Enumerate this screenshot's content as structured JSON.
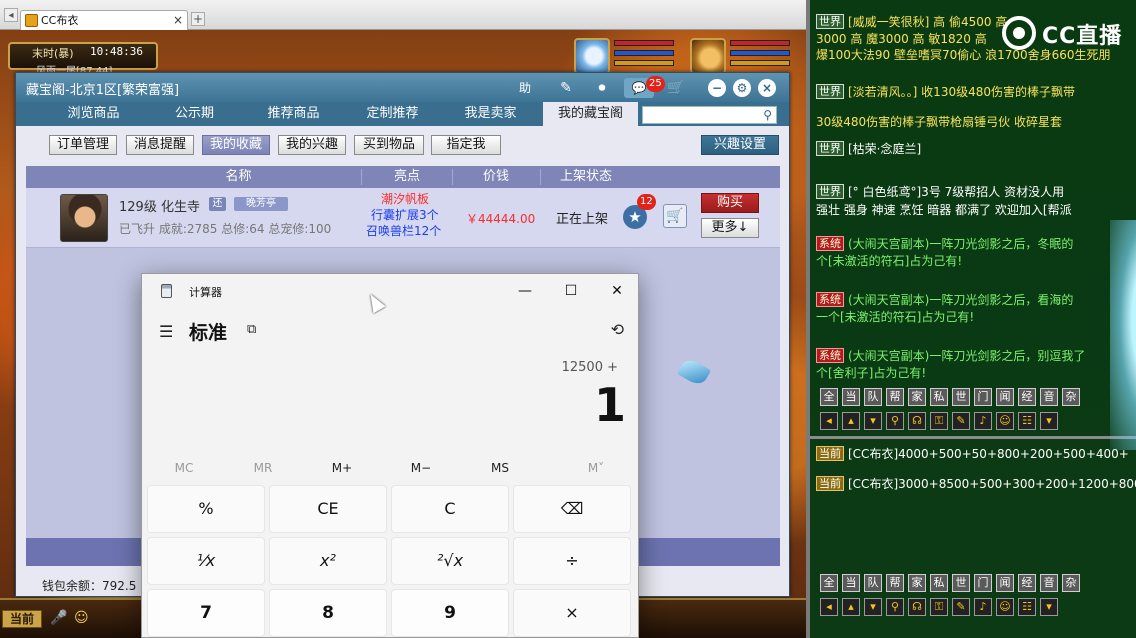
{
  "browser": {
    "tab_title": "CC布衣",
    "close_glyph": "×",
    "new_tab_glyph": "+",
    "arrow_glyph": "◂"
  },
  "game": {
    "hud_time_label": "末时(暴)",
    "hud_clock": "10:48:36",
    "map_text": "风雨一尾[87,44]"
  },
  "cbg": {
    "title": "藏宝阁-北京1区[繁荣富强]",
    "title_buttons": {
      "help": "助",
      "notify_count": "25"
    },
    "nav_tabs": [
      "浏览商品",
      "公示期",
      "推荐商品",
      "定制推荐",
      "我是卖家",
      "我的藏宝阁"
    ],
    "search_placeholder": "",
    "sub_buttons": [
      "订单管理",
      "消息提醒",
      "我的收藏",
      "我的兴趣",
      "买到物品",
      "指定我"
    ],
    "interest_button": "兴趣设置",
    "columns": [
      "名称",
      "亮点",
      "价钱",
      "上架状态"
    ],
    "row": {
      "level_school": "129级  化生寺",
      "tag1": "还",
      "tag2": "晚芳亭",
      "stats": "已飞升  成就:2785  总修:64  总宠修:100",
      "highlight1": "潮汐帆板",
      "highlight2": "行囊扩展3个",
      "highlight3": "召唤兽栏12个",
      "price": "￥44444.00",
      "status": "正在上架",
      "fav_count": "12",
      "buy": "购买",
      "more": "更多↓"
    },
    "wallet": "钱包余额：792.5"
  },
  "calculator": {
    "app_name": "计算器",
    "mode": "标准",
    "expression": "12500 +",
    "display": "1",
    "memory": [
      "MC",
      "MR",
      "M+",
      "M−",
      "MS",
      "M˅"
    ],
    "keys": [
      [
        "%",
        "CE",
        "C",
        "⌫"
      ],
      [
        "¹⁄x",
        "x²",
        "²√x",
        "÷"
      ],
      [
        "7",
        "8",
        "9",
        "×"
      ]
    ]
  },
  "chat": {
    "lines": [
      {
        "tag": "世界",
        "text": "[威威一笑很秋] 高 偷4500 高",
        "cls": "c-y"
      },
      {
        "tag": "",
        "text": "3000 高 魔3000 高 敏1820 高 ",
        "cls": "c-y"
      },
      {
        "tag": "",
        "text": "爆100大法90 壁垒嗜冥70偷心 浪1700舍身660生死朋",
        "cls": "c-y"
      },
      {
        "tag": "世界",
        "text": "[淡若清风。。] 收130级480伤害的棒子飘带",
        "cls": "c-y"
      },
      {
        "tag": "",
        "text": "30级480伤害的棒子飘带枪扇锤弓伙 收碎星套",
        "cls": "c-y"
      },
      {
        "tag": "世界",
        "text": "[枯荣·念庭兰]",
        "cls": "c-w"
      },
      {
        "tag": "",
        "text": "",
        "cls": "c-r"
      },
      {
        "tag": "世界",
        "text": "[° 白色纸鸢°]3号 7级帮招人  资材没人用",
        "cls": "c-w"
      },
      {
        "tag": "",
        "text": "强壮 强身 神速 烹饪 暗器 都满了 欢迎加入[帮派",
        "cls": "c-w"
      },
      {
        "tag": "系统",
        "text": "(大闹天宫副本)一阵刀光剑影之后，冬眠的",
        "cls": "c-g"
      },
      {
        "tag": "",
        "text": "个[未激活的符石]占为己有!",
        "cls": "c-g"
      },
      {
        "tag": "系统",
        "text": "(大闹天宫副本)一阵刀光剑影之后，看海的",
        "cls": "c-g"
      },
      {
        "tag": "",
        "text": "一个[未激活的符石]占为己有!",
        "cls": "c-g"
      },
      {
        "tag": "系统",
        "text": "(大闹天宫副本)一阵刀光剑影之后，别逗我了",
        "cls": "c-g"
      },
      {
        "tag": "",
        "text": "个[舍利子]占为己有!",
        "cls": "c-g"
      }
    ],
    "channel_tabs": [
      "全",
      "当",
      "队",
      "帮",
      "家",
      "私",
      "世",
      "门",
      "闻",
      "经",
      "音",
      "杂"
    ],
    "current_lines": [
      {
        "tag": "当前",
        "text": "[CC布衣]4000+500+50+800+200+500+400+"
      },
      {
        "tag": "当前",
        "text": "[CC布衣]3000+8500+500+300+200+1200+800"
      }
    ],
    "bottom_channel": "当前",
    "logo_text": "CC直播"
  }
}
